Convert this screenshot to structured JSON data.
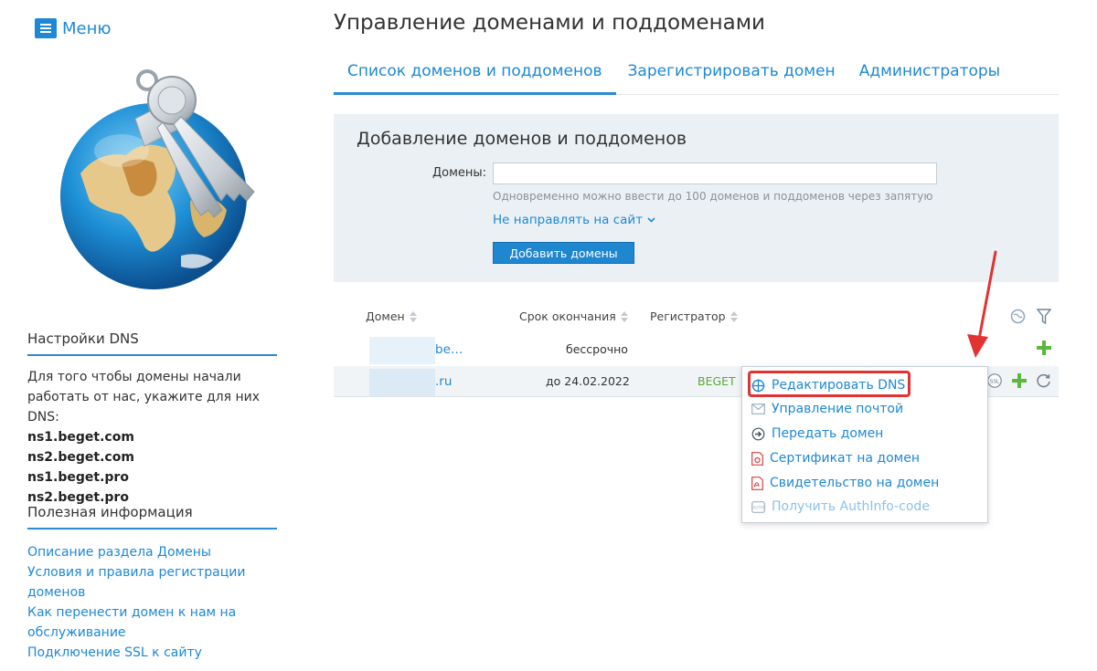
{
  "sidebar": {
    "menu_label": "Меню",
    "dns_title": "Настройки DNS",
    "dns_text": "Для того чтобы домены начали работать от нас, укажите для них DNS:",
    "ns": [
      "ns1.beget.com",
      "ns2.beget.com",
      "ns1.beget.pro",
      "ns2.beget.pro"
    ],
    "info_title": "Полезная информация",
    "links": [
      "Описание раздела Домены",
      "Условия и правила регистрации доменов",
      "Как перенести домен к нам на обслуживание",
      "Подключение SSL к сайту"
    ]
  },
  "header": {
    "title": "Управление доменами и поддоменами",
    "tabs": [
      "Список доменов и поддоменов",
      "Зарегистрировать домен",
      "Администраторы"
    ],
    "active_tab": 0
  },
  "add_panel": {
    "title": "Добавление доменов и поддоменов",
    "domains_label": "Домены:",
    "domains_value": "",
    "hint": "Одновременно можно ввести до 100 доменов и поддоменов через запятую",
    "redirect_label": "Не направлять на сайт",
    "add_button": "Добавить домены"
  },
  "table": {
    "columns": [
      "Домен",
      "Срок окончания",
      "Регистратор"
    ],
    "rows": [
      {
        "domain": "be…",
        "expiry": "бессрочно",
        "registrar": ""
      },
      {
        "domain": ".ru",
        "expiry": "до 24.02.2022",
        "registrar": "BEGET"
      }
    ]
  },
  "dropdown": {
    "items": [
      {
        "label": "Редактировать DNS",
        "icon": "dns-icon",
        "enabled": true
      },
      {
        "label": "Управление почтой",
        "icon": "mail-icon",
        "enabled": true
      },
      {
        "label": "Передать домен",
        "icon": "transfer-icon",
        "enabled": true
      },
      {
        "label": "Сертификат на домен",
        "icon": "certificate-icon",
        "enabled": true
      },
      {
        "label": "Свидетельство на домен",
        "icon": "pdf-icon",
        "enabled": true
      },
      {
        "label": "Получить AuthInfo-code",
        "icon": "auth-icon",
        "enabled": false
      }
    ],
    "highlighted_index": 0
  },
  "colors": {
    "accent": "#1e88d6",
    "panel_bg": "#ebf0f4",
    "registrar_green": "#5aa832",
    "highlight_red": "#e23232"
  }
}
